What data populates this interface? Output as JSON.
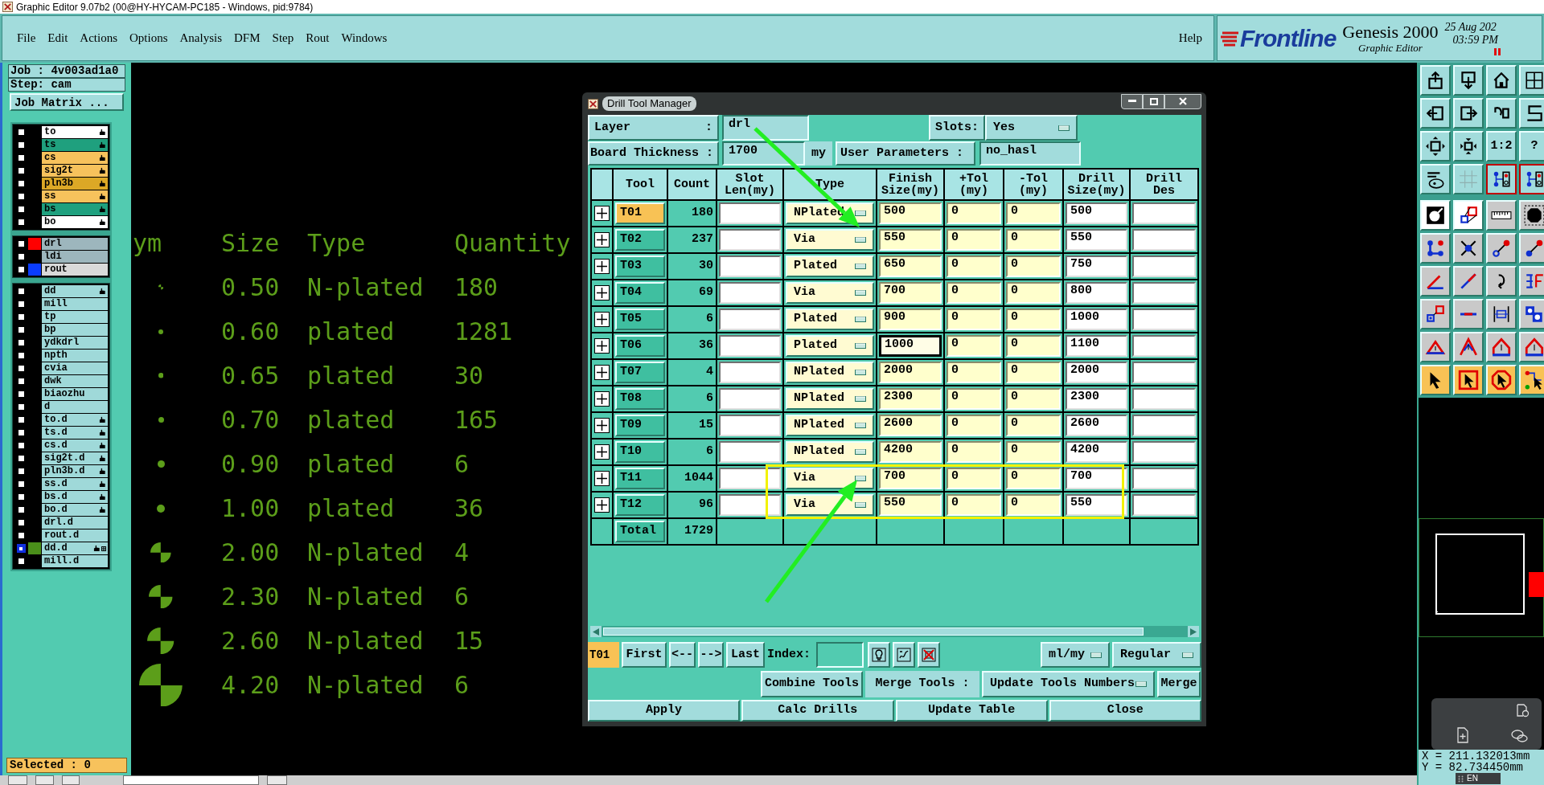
{
  "window": {
    "title": "Graphic Editor 9.07b2 (00@HY-HYCAM-PC185 - Windows, pid:9784)"
  },
  "menu": [
    "File",
    "Edit",
    "Actions",
    "Options",
    "Analysis",
    "DFM",
    "Step",
    "Rout",
    "Windows"
  ],
  "help": "Help",
  "brand": {
    "logo": "Frontline",
    "product": "Genesis 2000",
    "subtitle": "Graphic Editor",
    "date": "25 Aug 202",
    "time": "03:59 PM"
  },
  "job": "Job : 4v003ad1a0",
  "step": "Step: cam",
  "job_matrix": "Job Matrix ...",
  "layer_groups": [
    [
      {
        "name": "to",
        "color": "#ffffff",
        "affected": true,
        "selected": false
      },
      {
        "name": "ts",
        "color": "#1fa07e",
        "affected": true,
        "selected": false
      },
      {
        "name": "cs",
        "color": "#f7c25c",
        "affected": true,
        "selected": false
      },
      {
        "name": "sig2t",
        "color": "#f7c25c",
        "affected": true,
        "selected": false
      },
      {
        "name": "pln3b",
        "color": "#dca826",
        "affected": true,
        "selected": false
      },
      {
        "name": "ss",
        "color": "#f7c25c",
        "affected": true,
        "selected": false
      },
      {
        "name": "bs",
        "color": "#1fa07e",
        "affected": true,
        "selected": false
      },
      {
        "name": "bo",
        "color": "#ffffff",
        "affected": true,
        "selected": false
      }
    ],
    [
      {
        "name": "drl",
        "color": "#9db6bd",
        "swatch": {
          "color": "#ff0000"
        },
        "affected": false,
        "selected": false
      },
      {
        "name": "ldi",
        "color": "#9db6bd",
        "affected": false,
        "selected": false
      },
      {
        "name": "rout",
        "color": "#d9d9d9",
        "swatch": {
          "color": "#0a3cff"
        },
        "affected": false,
        "selected": false
      }
    ],
    [
      {
        "name": "dd",
        "color": "#9fd9d9",
        "affected": true,
        "selected": false
      },
      {
        "name": "mill",
        "color": "#9fd9d9",
        "affected": false,
        "selected": false
      },
      {
        "name": "tp",
        "color": "#9fd9d9",
        "affected": false,
        "selected": false
      },
      {
        "name": "bp",
        "color": "#9fd9d9",
        "affected": false,
        "selected": false
      },
      {
        "name": "ydkdrl",
        "color": "#9fd9d9",
        "affected": false,
        "selected": false
      },
      {
        "name": "npth",
        "color": "#9fd9d9",
        "affected": false,
        "selected": false
      },
      {
        "name": "cvia",
        "color": "#9fd9d9",
        "affected": false,
        "selected": false
      },
      {
        "name": "dwk",
        "color": "#9fd9d9",
        "affected": false,
        "selected": false
      },
      {
        "name": "biaozhu",
        "color": "#9fd9d9",
        "affected": false,
        "selected": false
      },
      {
        "name": "d",
        "color": "#9fd9d9",
        "affected": false,
        "selected": false
      },
      {
        "name": "to.d",
        "color": "#9fd9d9",
        "affected": true,
        "selected": false
      },
      {
        "name": "ts.d",
        "color": "#9fd9d9",
        "affected": true,
        "selected": false
      },
      {
        "name": "cs.d",
        "color": "#9fd9d9",
        "affected": true,
        "selected": false
      },
      {
        "name": "sig2t.d",
        "color": "#9fd9d9",
        "affected": true,
        "selected": false
      },
      {
        "name": "pln3b.d",
        "color": "#9fd9d9",
        "affected": true,
        "selected": false
      },
      {
        "name": "ss.d",
        "color": "#9fd9d9",
        "affected": true,
        "selected": false
      },
      {
        "name": "bs.d",
        "color": "#9fd9d9",
        "affected": true,
        "selected": false
      },
      {
        "name": "bo.d",
        "color": "#9fd9d9",
        "affected": true,
        "selected": false
      },
      {
        "name": "drl.d",
        "color": "#9fd9d9",
        "affected": false,
        "selected": false
      },
      {
        "name": "rout.d",
        "color": "#9fd9d9",
        "affected": false,
        "selected": false
      },
      {
        "name": "dd.d",
        "color": "#9fd9d9",
        "swatch": {
          "color": "#4a8f1a"
        },
        "affected": true,
        "selected": true
      },
      {
        "name": "mill.d",
        "color": "#9fd9d9",
        "affected": false,
        "selected": false
      }
    ]
  ],
  "selected_count": "Selected : 0",
  "legend": {
    "columns": [
      "ym",
      "Size",
      "Type",
      "Quantity"
    ],
    "rows": [
      {
        "kind": "split",
        "size": "0.50",
        "type": "N-plated",
        "quantity": "180"
      },
      {
        "kind": "dot",
        "size": "0.60",
        "type": "plated",
        "quantity": "1281"
      },
      {
        "kind": "dot",
        "size": "0.65",
        "type": "plated",
        "quantity": "30"
      },
      {
        "kind": "dot",
        "size": "0.70",
        "type": "plated",
        "quantity": "165"
      },
      {
        "kind": "dot",
        "size": "0.90",
        "type": "plated",
        "quantity": "6"
      },
      {
        "kind": "dot",
        "size": "1.00",
        "type": "plated",
        "quantity": "36"
      },
      {
        "kind": "split",
        "size": "2.00",
        "type": "N-plated",
        "quantity": "4"
      },
      {
        "kind": "split",
        "size": "2.30",
        "type": "N-plated",
        "quantity": "6"
      },
      {
        "kind": "split",
        "size": "2.60",
        "type": "N-plated",
        "quantity": "15"
      },
      {
        "kind": "split",
        "size": "4.20",
        "type": "N-plated",
        "quantity": "6"
      }
    ]
  },
  "dialog": {
    "title": "Drill Tool Manager",
    "layer_label": "Layer",
    "layer_colon": ":",
    "layer": "drl",
    "slots_label": "Slots:",
    "slots": "Yes",
    "thickness_label": "Board Thickness :",
    "thickness": "1700",
    "thickness_unit": "my",
    "params_label": "User Parameters :",
    "params": "no_hasl",
    "columns": [
      "Tool",
      "Count",
      "Slot\nLen(my)",
      "Type",
      "Finish\nSize(my)",
      "+Tol\n(my)",
      "-Tol\n(my)",
      "Drill\nSize(my)",
      "Drill\nDes"
    ],
    "rows": [
      {
        "tool": "T01",
        "selected": true,
        "count": "180",
        "type": "NPlated",
        "finish": "500",
        "plus_tol": "0",
        "minus_tol": "0",
        "drill_size": "500",
        "focused": false,
        "highlighted": false
      },
      {
        "tool": "T02",
        "selected": false,
        "count": "237",
        "type": "Via",
        "finish": "550",
        "plus_tol": "0",
        "minus_tol": "0",
        "drill_size": "550",
        "focused": false,
        "highlighted": false
      },
      {
        "tool": "T03",
        "selected": false,
        "count": "30",
        "type": "Plated",
        "finish": "650",
        "plus_tol": "0",
        "minus_tol": "0",
        "drill_size": "750",
        "focused": false,
        "highlighted": false
      },
      {
        "tool": "T04",
        "selected": false,
        "count": "69",
        "type": "Via",
        "finish": "700",
        "plus_tol": "0",
        "minus_tol": "0",
        "drill_size": "800",
        "focused": false,
        "highlighted": false
      },
      {
        "tool": "T05",
        "selected": false,
        "count": "6",
        "type": "Plated",
        "finish": "900",
        "plus_tol": "0",
        "minus_tol": "0",
        "drill_size": "1000",
        "focused": false,
        "highlighted": false
      },
      {
        "tool": "T06",
        "selected": false,
        "count": "36",
        "type": "Plated",
        "finish": "1000",
        "plus_tol": "0",
        "minus_tol": "0",
        "drill_size": "1100",
        "focused": true,
        "highlighted": false
      },
      {
        "tool": "T07",
        "selected": false,
        "count": "4",
        "type": "NPlated",
        "finish": "2000",
        "plus_tol": "0",
        "minus_tol": "0",
        "drill_size": "2000",
        "focused": false,
        "highlighted": false
      },
      {
        "tool": "T08",
        "selected": false,
        "count": "6",
        "type": "NPlated",
        "finish": "2300",
        "plus_tol": "0",
        "minus_tol": "0",
        "drill_size": "2300",
        "focused": false,
        "highlighted": false
      },
      {
        "tool": "T09",
        "selected": false,
        "count": "15",
        "type": "NPlated",
        "finish": "2600",
        "plus_tol": "0",
        "minus_tol": "0",
        "drill_size": "2600",
        "focused": false,
        "highlighted": false
      },
      {
        "tool": "T10",
        "selected": false,
        "count": "6",
        "type": "NPlated",
        "finish": "4200",
        "plus_tol": "0",
        "minus_tol": "0",
        "drill_size": "4200",
        "focused": false,
        "highlighted": false
      },
      {
        "tool": "T11",
        "selected": false,
        "count": "1044",
        "type": "Via",
        "finish": "700",
        "plus_tol": "0",
        "minus_tol": "0",
        "drill_size": "700",
        "focused": false,
        "highlighted": true
      },
      {
        "tool": "T12",
        "selected": false,
        "count": "96",
        "type": "Via",
        "finish": "550",
        "plus_tol": "0",
        "minus_tol": "0",
        "drill_size": "550",
        "focused": false,
        "highlighted": true
      }
    ],
    "total_label": "Total",
    "total": "1729",
    "current_tool": "T01",
    "nav": [
      "First",
      "<--",
      "-->",
      "Last"
    ],
    "index_label": "Index:",
    "units": "ml/my",
    "mode": "Regular",
    "combine": "Combine Tools",
    "merge_label": "Merge Tools :",
    "merge_mode": "Update Tools Numbers",
    "merge": "Merge",
    "actions": [
      "Apply",
      "Calc Drills",
      "Update Table",
      "Close"
    ]
  },
  "toolbar_labels": [
    "1:2",
    "?"
  ],
  "coordinates": {
    "x": "X = 211.132013mm",
    "y": "Y = 82.734450mm"
  },
  "input_indicator": "EN"
}
